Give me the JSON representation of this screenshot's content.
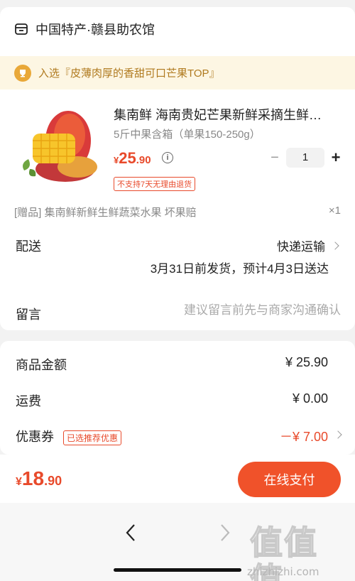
{
  "shop": {
    "name": "中国特产·赣县助农馆",
    "icon": "store-icon"
  },
  "rank": {
    "text": "入选『皮薄肉厚的香甜可口芒果TOP』",
    "icon": "trophy-icon"
  },
  "product": {
    "title": "集南鲜 海南贵妃芒果新鲜采摘生鲜…",
    "spec": "5斤中果含箱（单果150-250g）",
    "price_yen": "¥",
    "price_int": "25",
    "price_dec": ".90",
    "quantity": "1",
    "minus": "−",
    "plus": "+",
    "no_return": "不支持7天无理由退货",
    "info": "i"
  },
  "gift": {
    "text": "[赠品] 集南鲜新鲜生鲜蔬菜水果 坏果赔",
    "qty": "×1"
  },
  "shipping": {
    "label": "配送",
    "method": "快递运输",
    "time": "3月31日前发货，预计4月3日送达"
  },
  "message": {
    "label": "留言",
    "placeholder": "建议留言前先与商家沟通确认"
  },
  "summary": {
    "goods_label": "商品金额",
    "goods_value": "¥ 25.90",
    "ship_label": "运费",
    "ship_value": "¥ 0.00",
    "coupon_label": "优惠券",
    "coupon_badge": "已选推荐优惠",
    "coupon_value": "－¥ 7.00"
  },
  "pay": {
    "total_yen": "¥",
    "total_int": "18",
    "total_dec": ".90",
    "button": "在线支付"
  },
  "watermark": {
    "logo": "值值值",
    "url": "zhizhizhi.com"
  },
  "colors": {
    "accent": "#e84a2b",
    "button": "#f0522a",
    "banner_bg": "#fdf6e3",
    "banner_text": "#b07a1f"
  }
}
